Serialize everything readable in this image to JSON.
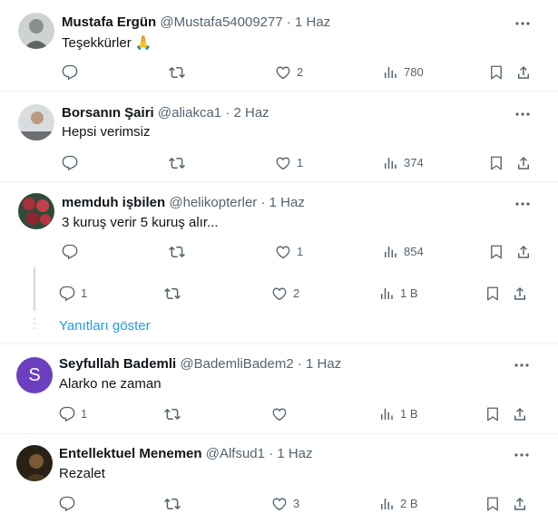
{
  "tweets": [
    {
      "name": "Mustafa Ergün",
      "handle": "@Mustafa54009277",
      "date": "1 Haz",
      "text": "Teşekkürler 🙏",
      "replies": "",
      "retweets": "",
      "likes": "2",
      "views": "780",
      "avatar_color": "#8a8f8c"
    },
    {
      "name": "Borsanın Şairi",
      "handle": "@aliakca1",
      "date": "2 Haz",
      "text": "Hepsi verimsiz",
      "replies": "",
      "retweets": "",
      "likes": "1",
      "views": "374",
      "avatar_color": "#6b6f73"
    },
    {
      "name": "memduh işbilen",
      "handle": "@helikopterler",
      "date": "1 Haz",
      "text": "3 kuruş verir 5 kuruş alır...",
      "replies": "",
      "retweets": "",
      "likes": "1",
      "views": "854",
      "avatar_color": "#a8303a"
    },
    {
      "name": "Seyfullah Bademli",
      "handle": "@BademliBadem2",
      "date": "1 Haz",
      "text": "Alarko ne zaman",
      "replies": "1",
      "retweets": "",
      "likes": "",
      "views": "1 B",
      "avatar_letter": "S",
      "avatar_color": "#6b3fbf"
    },
    {
      "name": "Entellektuel Menemen",
      "handle": "@Alfsud1",
      "date": "1 Haz",
      "text": "Rezalet",
      "replies": "",
      "retweets": "",
      "likes": "3",
      "views": "2 B",
      "avatar_color": "#3d2e1c"
    }
  ],
  "thread_stub": {
    "replies": "1",
    "retweets": "",
    "likes": "2",
    "views": "1 B"
  },
  "show_replies_label": "Yanıtları göster",
  "colors": {
    "accent": "#1d9bf0",
    "secondary_text": "#536471",
    "divider": "#eff3f4"
  },
  "icons": [
    "reply-icon",
    "retweet-icon",
    "like-icon",
    "views-icon",
    "bookmark-icon",
    "share-icon",
    "more-icon"
  ]
}
